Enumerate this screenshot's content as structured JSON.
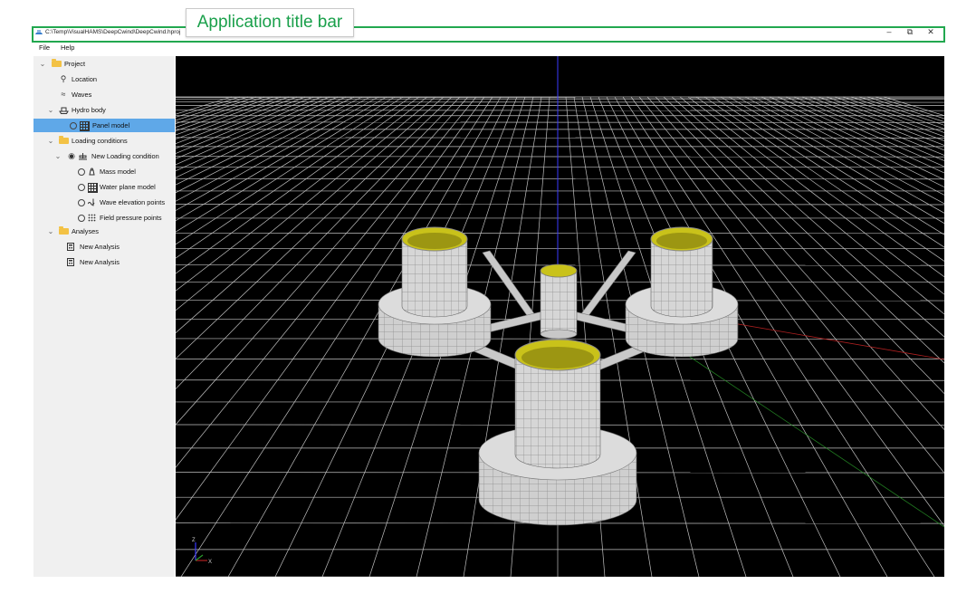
{
  "annotation": {
    "label": "Application title bar"
  },
  "window": {
    "title": "C:\\Temp\\VisualHAMS\\DeepCwind\\DeepCwind.hproj"
  },
  "menu": {
    "items": [
      "File",
      "Help"
    ]
  },
  "tree": [
    {
      "label": "Project",
      "icon": "folder-icon",
      "level": 0,
      "expanded": true
    },
    {
      "label": "Location",
      "icon": "location-pin-icon",
      "level": 1
    },
    {
      "label": "Waves",
      "icon": "waves-icon",
      "level": 1
    },
    {
      "label": "Hydro body",
      "icon": "ship-icon",
      "level": 1,
      "expanded": true
    },
    {
      "label": "Panel model",
      "icon": "grid-icon",
      "level": 2,
      "selected": true,
      "radio": true
    },
    {
      "label": "Loading conditions",
      "icon": "folder-icon",
      "level": 1,
      "expanded": true
    },
    {
      "label": "New Loading condition",
      "icon": "scale-icon",
      "level": 2,
      "expanded": true,
      "eye": true
    },
    {
      "label": "Mass model",
      "icon": "weight-icon",
      "level": 3,
      "radio": true
    },
    {
      "label": "Water plane model",
      "icon": "grid-icon",
      "level": 3,
      "radio": true
    },
    {
      "label": "Wave elevation points",
      "icon": "wave-point-icon",
      "level": 3,
      "radio": true
    },
    {
      "label": "Field pressure points",
      "icon": "dot-grid-icon",
      "level": 3,
      "radio": true
    },
    {
      "label": "Analyses",
      "icon": "folder-icon",
      "level": 1,
      "expanded": true
    },
    {
      "label": "New Analysis",
      "icon": "calculator-icon",
      "level": 2
    },
    {
      "label": "New Analysis",
      "icon": "calculator-icon",
      "level": 2
    }
  ],
  "viewport": {
    "axis_labels": {
      "z": "Z",
      "x": "X"
    },
    "colors": {
      "background": "#000000",
      "hull": "#d8d8d8",
      "column_top": "#c9c21a",
      "grid": "#ffffff",
      "axis_z": "#3a3aff",
      "axis_x": "#b02020",
      "axis_y": "#2a9a2a"
    }
  }
}
